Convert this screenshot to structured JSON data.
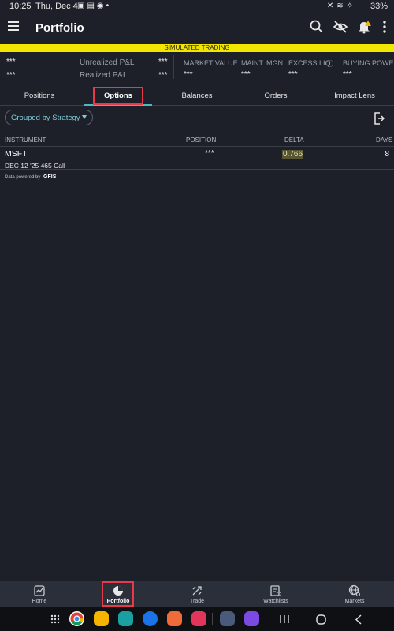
{
  "status": {
    "time": "10:25",
    "date": "Thu, Dec 4",
    "battery": "33%"
  },
  "app": {
    "title": "Portfolio"
  },
  "banner": {
    "text": "SIMULATED TRADING"
  },
  "summary": {
    "left": [
      {
        "value": "***",
        "label": "Unrealized P&L",
        "right_value": "***"
      },
      {
        "value": "***",
        "label": "Realized P&L",
        "right_value": "***"
      }
    ],
    "metrics": [
      {
        "label": "MARKET VALUE",
        "value": "***"
      },
      {
        "label": "MAINT. MGN",
        "value": "***"
      },
      {
        "label": "EXCESS LIQ",
        "value": "***",
        "info": "ⓘ"
      },
      {
        "label": "BUYING POWER",
        "value": "***"
      }
    ]
  },
  "tabs": [
    {
      "label": "Positions",
      "active": false
    },
    {
      "label": "Options",
      "active": true
    },
    {
      "label": "Balances",
      "active": false
    },
    {
      "label": "Orders",
      "active": false
    },
    {
      "label": "Impact Lens",
      "active": false
    }
  ],
  "filter": {
    "label": "Grouped by Strategy"
  },
  "table": {
    "columns": [
      "INSTRUMENT",
      "POSITION",
      "DELTA",
      "DAYS"
    ],
    "rows": [
      {
        "symbol": "MSFT",
        "description": "DEC 12 '25 465 Call",
        "position": "***",
        "delta": "0.766",
        "days": "8"
      }
    ]
  },
  "powered_by": {
    "text": "Data powered by",
    "brand": "GFIS"
  },
  "bottom_nav": [
    {
      "label": "Home",
      "icon": "home-chart-icon",
      "active": false
    },
    {
      "label": "Portfolio",
      "icon": "portfolio-pie-icon",
      "active": true
    },
    {
      "label": "Trade",
      "icon": "trade-arrows-icon",
      "active": false
    },
    {
      "label": "Watchlists",
      "icon": "watchlist-icon",
      "active": false
    },
    {
      "label": "Markets",
      "icon": "markets-globe-icon",
      "active": false
    }
  ],
  "colors": {
    "background": "#1d2029",
    "accent": "#4ab8c6",
    "banner": "#f2e500",
    "highlight": "#e8394b"
  }
}
